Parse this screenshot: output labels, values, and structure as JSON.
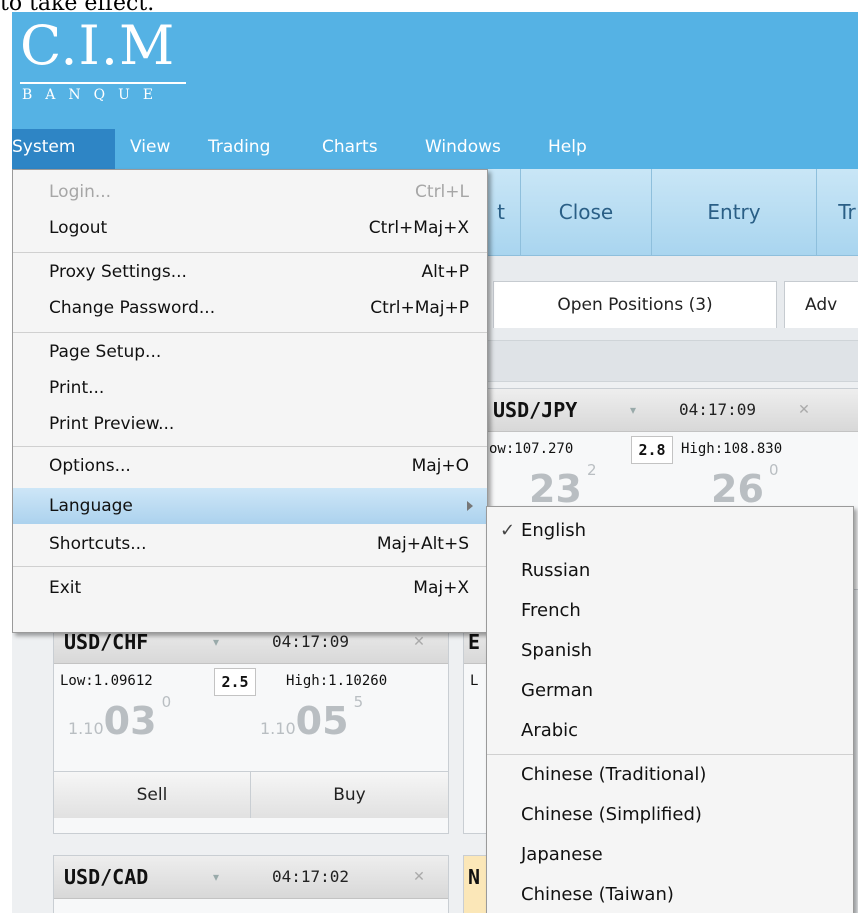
{
  "caption": "to take effect.",
  "logo": {
    "main": "C.I.M",
    "sub": "BANQUE"
  },
  "menubar": [
    "System",
    "View",
    "Trading",
    "Charts",
    "Windows",
    "Help"
  ],
  "toolbar": {
    "partial_label": "t",
    "buttons": [
      "Close",
      "Entry",
      "Tr"
    ]
  },
  "tabs": {
    "open_positions": "Open Positions (3)",
    "partial": "Adv"
  },
  "system_menu": [
    {
      "label": "Login...",
      "shortcut": "Ctrl+L",
      "disabled": true
    },
    {
      "label": "Logout",
      "shortcut": "Ctrl+Maj+X"
    },
    {
      "label": "Proxy Settings...",
      "shortcut": "Alt+P"
    },
    {
      "label": "Change Password...",
      "shortcut": "Ctrl+Maj+P"
    },
    {
      "label": "Page Setup...",
      "shortcut": ""
    },
    {
      "label": "Print...",
      "shortcut": ""
    },
    {
      "label": "Print Preview...",
      "shortcut": ""
    },
    {
      "label": "Options...",
      "shortcut": "Maj+O"
    },
    {
      "label": "Language",
      "shortcut": "",
      "submenu": true,
      "highlighted": true
    },
    {
      "label": "Shortcuts...",
      "shortcut": "Maj+Alt+S"
    },
    {
      "label": "Exit",
      "shortcut": "Maj+X"
    }
  ],
  "language_menu": [
    {
      "label": "English",
      "checked": true
    },
    {
      "label": "Russian"
    },
    {
      "label": "French"
    },
    {
      "label": "Spanish"
    },
    {
      "label": "German"
    },
    {
      "label": "Arabic"
    },
    {
      "label": "Chinese (Traditional)"
    },
    {
      "label": "Chinese (Simplified)"
    },
    {
      "label": "Japanese"
    },
    {
      "label": "Chinese (Taiwan)"
    }
  ],
  "cards": {
    "usdjpy": {
      "pair": "USD/JPY",
      "time": "04:17:09",
      "low": "ow:107.270",
      "spread": "2.8",
      "high": "High:108.830",
      "sell_big": "23",
      "sell_sup": "2",
      "buy_big": "26",
      "buy_sup": "0"
    },
    "usdchf": {
      "pair": "USD/CHF",
      "time": "04:17:09",
      "low": "Low:1.09612",
      "spread": "2.5",
      "high": "High:1.10260",
      "sell_small": "1.10",
      "sell_big": "03",
      "sell_sup": "0",
      "buy_small": "1.10",
      "buy_big": "05",
      "buy_sup": "5",
      "sell_label": "Sell",
      "buy_label": "Buy"
    },
    "usdcad": {
      "pair": "USD/CAD",
      "time": "04:17:02"
    },
    "partial_right": {
      "top_letter": "E",
      "low_letter": "L",
      "bottom_letter": "N"
    }
  },
  "glyphs": {
    "dropdown": "▾",
    "close": "✕",
    "check": "✓"
  }
}
